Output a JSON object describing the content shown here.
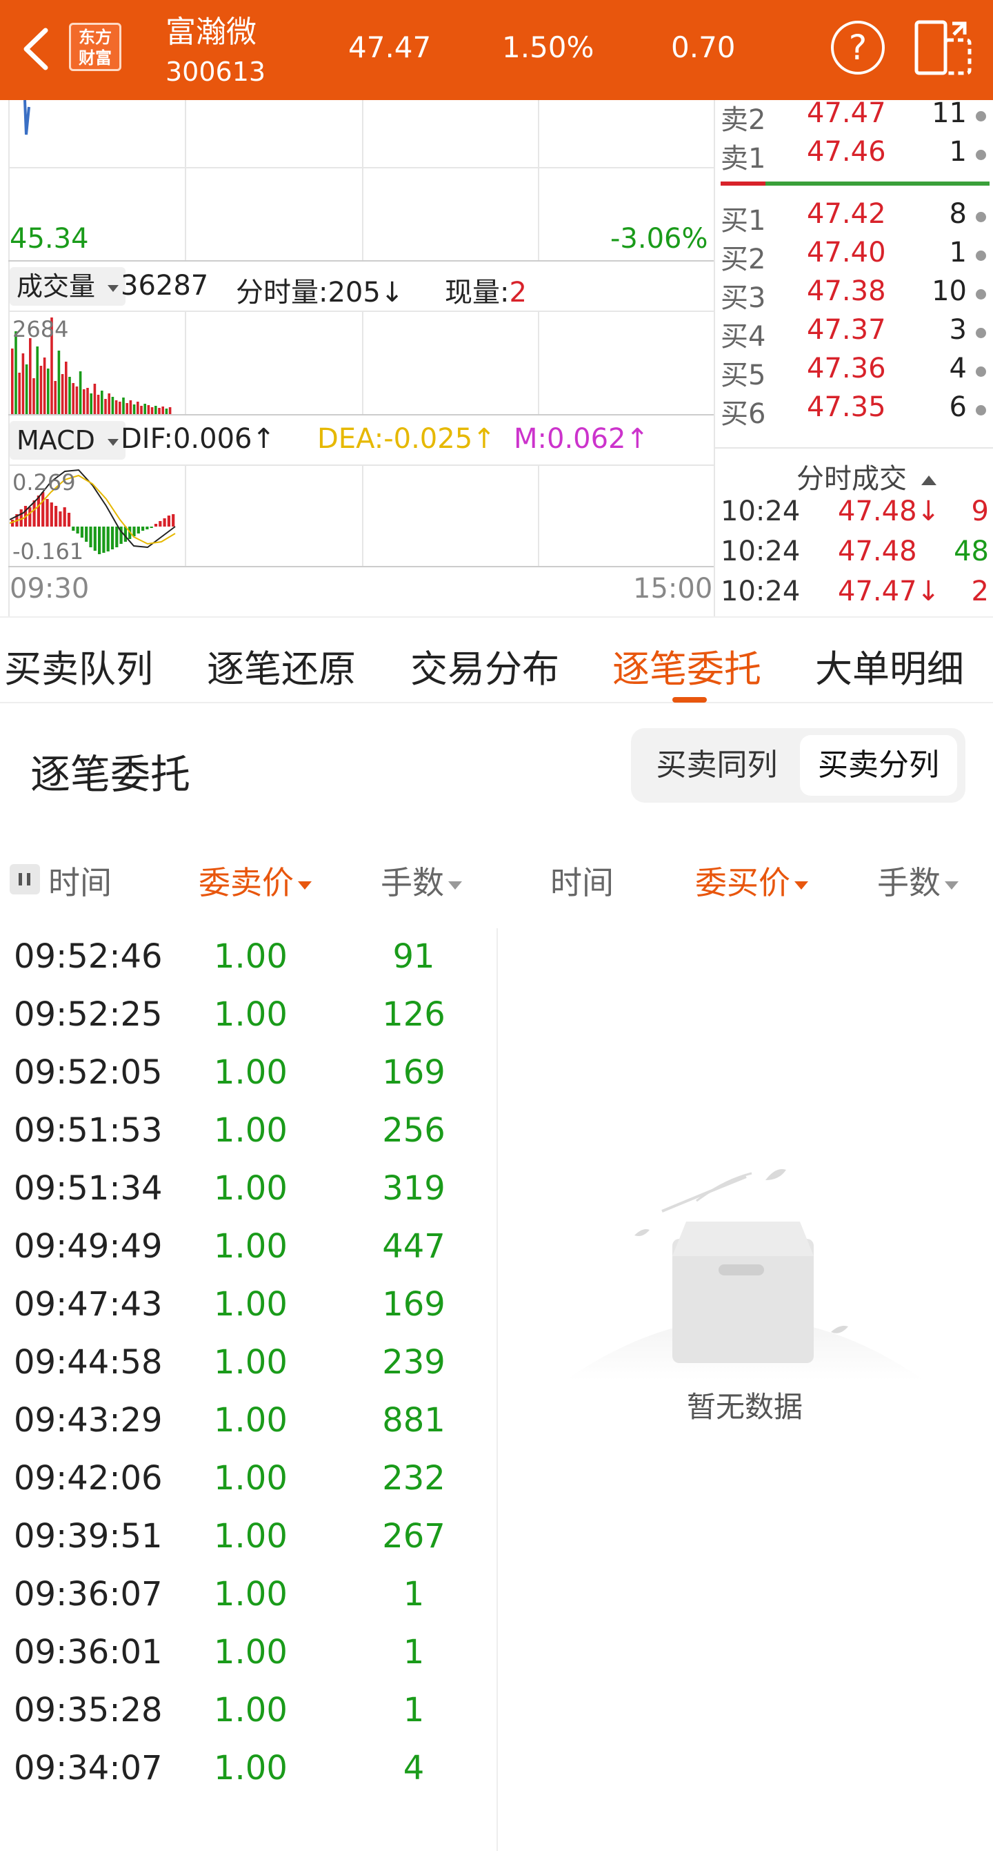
{
  "header": {
    "logo_text_1": "东方",
    "logo_text_2": "财富",
    "stock_name": "富瀚微",
    "stock_code": "300613",
    "price": "47.47",
    "change_pct": "1.50%",
    "change_amt": "0.70",
    "help_symbol": "?"
  },
  "chart": {
    "low_price": "45.34",
    "low_pct": "-3.06%",
    "volume_selector": "成交量",
    "volume_total": "36287",
    "minute_volume": "分时量:205↓",
    "current_volume_label": "现量:",
    "current_volume_value": "2",
    "vol_max": "2684",
    "macd_selector": "MACD",
    "dif": "DIF:0.006↑",
    "dea": "DEA:-0.025↑",
    "m": "M:0.062↑",
    "macd_top": "0.269",
    "macd_bottom": "-0.161",
    "time_start": "09:30",
    "time_end": "15:00"
  },
  "order_book": {
    "sell": [
      {
        "label": "卖2",
        "price": "47.47",
        "qty": "11"
      },
      {
        "label": "卖1",
        "price": "47.46",
        "qty": "1"
      }
    ],
    "buy": [
      {
        "label": "买1",
        "price": "47.42",
        "qty": "8"
      },
      {
        "label": "买2",
        "price": "47.40",
        "qty": "1"
      },
      {
        "label": "买3",
        "price": "47.38",
        "qty": "10"
      },
      {
        "label": "买4",
        "price": "47.37",
        "qty": "3"
      },
      {
        "label": "买5",
        "price": "47.36",
        "qty": "4"
      },
      {
        "label": "买6",
        "price": "47.35",
        "qty": "6"
      }
    ]
  },
  "ticks": {
    "title": "分时成交",
    "rows": [
      {
        "time": "10:24",
        "price": "47.48↓",
        "qty": "9"
      },
      {
        "time": "10:24",
        "price": "47.48",
        "qty": "48"
      },
      {
        "time": "10:24",
        "price": "47.47↓",
        "qty": "2"
      }
    ]
  },
  "tabs": [
    "买卖队列",
    "逐笔还原",
    "交易分布",
    "逐笔委托",
    "大单明细"
  ],
  "active_tab": "逐笔委托",
  "section": {
    "title": "逐笔委托",
    "seg_same": "买卖同列",
    "seg_split": "买卖分列"
  },
  "columns": {
    "sell_time": "时间",
    "sell_price": "委卖价",
    "sell_qty": "手数",
    "buy_time": "时间",
    "buy_price": "委买价",
    "buy_qty": "手数"
  },
  "sell_orders": [
    {
      "time": "09:52:46",
      "price": "1.00",
      "qty": "91"
    },
    {
      "time": "09:52:25",
      "price": "1.00",
      "qty": "126"
    },
    {
      "time": "09:52:05",
      "price": "1.00",
      "qty": "169"
    },
    {
      "time": "09:51:53",
      "price": "1.00",
      "qty": "256"
    },
    {
      "time": "09:51:34",
      "price": "1.00",
      "qty": "319"
    },
    {
      "time": "09:49:49",
      "price": "1.00",
      "qty": "447"
    },
    {
      "time": "09:47:43",
      "price": "1.00",
      "qty": "169"
    },
    {
      "time": "09:44:58",
      "price": "1.00",
      "qty": "239"
    },
    {
      "time": "09:43:29",
      "price": "1.00",
      "qty": "881"
    },
    {
      "time": "09:42:06",
      "price": "1.00",
      "qty": "232"
    },
    {
      "time": "09:39:51",
      "price": "1.00",
      "qty": "267"
    },
    {
      "time": "09:36:07",
      "price": "1.00",
      "qty": "1"
    },
    {
      "time": "09:36:01",
      "price": "1.00",
      "qty": "1"
    },
    {
      "time": "09:35:28",
      "price": "1.00",
      "qty": "1"
    },
    {
      "time": "09:34:07",
      "price": "1.00",
      "qty": "4"
    }
  ],
  "empty_text": "暂无数据",
  "colors": {
    "brand": "#e8560d",
    "up": "#d8222a",
    "down": "#1a9b1a",
    "dea": "#e6b800",
    "m": "#cc33cc"
  }
}
